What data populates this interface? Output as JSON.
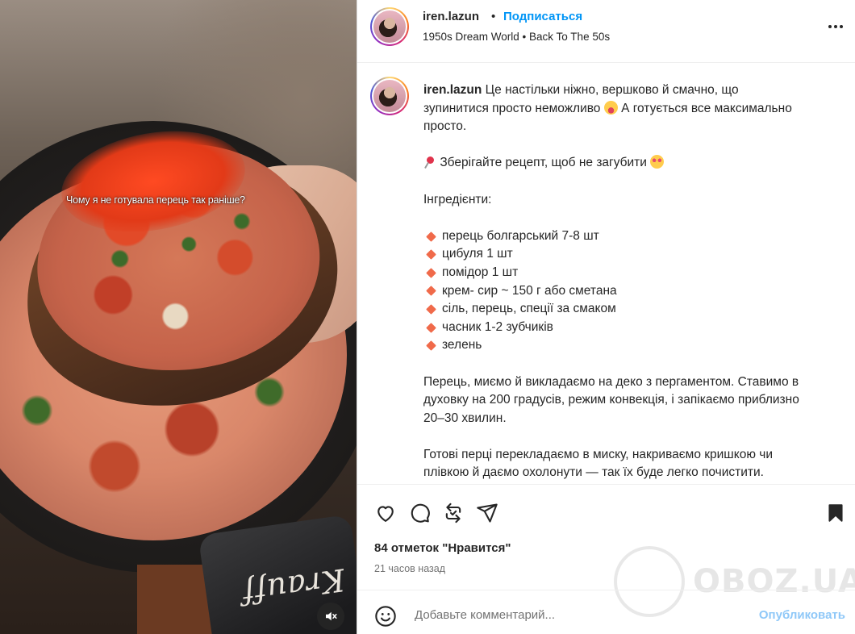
{
  "media": {
    "overlay_text": "Чому я не готувала перець так раніше?",
    "brand_text": "Krauff",
    "mute_icon": "speaker-muted-icon"
  },
  "header": {
    "username": "iren.lazun",
    "separator": "•",
    "follow_label": "Подписаться",
    "subtitle": "1950s Dream World • Back To The 50s",
    "more_icon": "more-horizontal-icon"
  },
  "caption": {
    "username": "iren.lazun",
    "intro_text": "Це настільки ніжно, вершково й смачно, що зупинитися просто неможливо",
    "intro_tail": "А готується все максимально просто.",
    "save_text": "Зберігайте рецепт, щоб не загубити",
    "ingredients_title": "Інгредієнти:",
    "ingredients": [
      "перець болгарський 7-8 шт",
      "цибуля 1 шт",
      "помідор 1 шт",
      "крем- сир ~ 150 г або сметана",
      "сіль, перець, спеції за смаком",
      "часник 1-2 зубчиків",
      "зелень"
    ],
    "step1": "Перець, миємо й викладаємо на деко з пергаментом. Ставимо в духовку на 200 градусів, режим конвекція, і запікаємо приблизно 20–30 хвилин.",
    "step2": "Готові перці перекладаємо в миску, накриваємо кришкою чи плівкою й даємо охолонути — так їх буде легко почистити."
  },
  "actions": {
    "icons": [
      "heart-icon",
      "comment-icon",
      "repost-icon",
      "share-icon",
      "bookmark-icon"
    ],
    "likes": "84 отметок \"Нравится\"",
    "time_ago": "21 часов назад"
  },
  "comment": {
    "placeholder": "Добавьте комментарий...",
    "post_label": "Опубликовать"
  },
  "watermark": {
    "text": "OBOZ.UA"
  },
  "colors": {
    "link_blue": "#0095f6",
    "post_disabled": "#8fc8f8",
    "text": "#262626",
    "muted": "#737373",
    "bullet": "#f06a4a"
  }
}
